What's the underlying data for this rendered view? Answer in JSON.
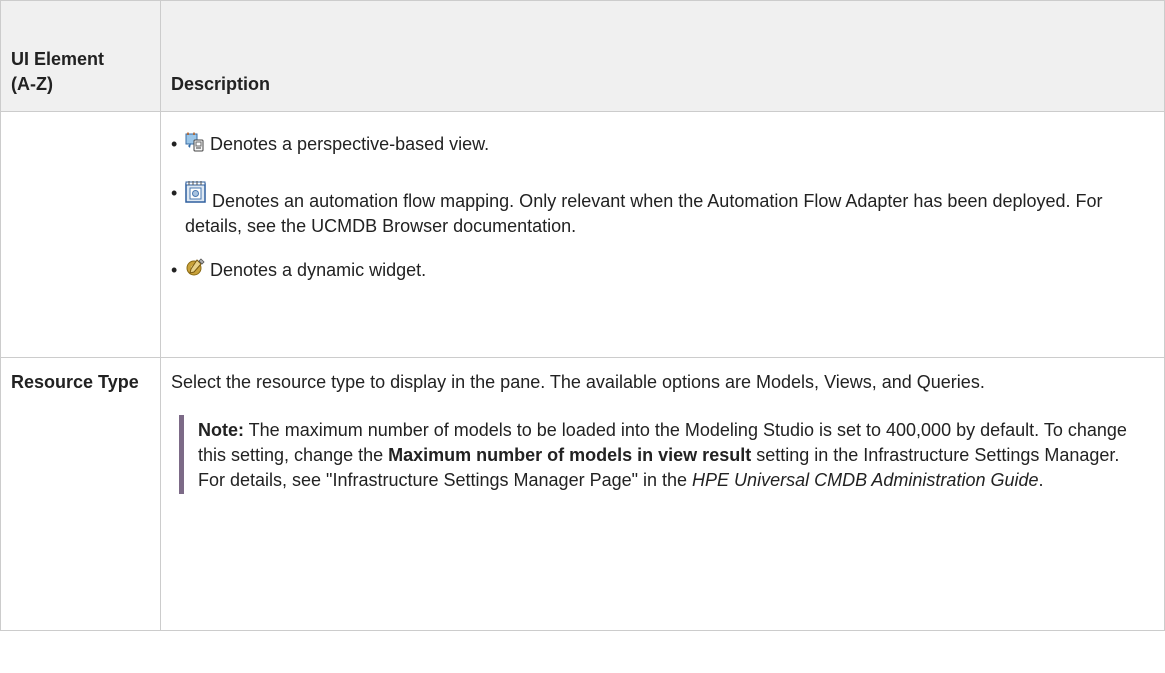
{
  "table": {
    "header": {
      "col1_line1": "UI Element",
      "col1_line2": "(A-Z)",
      "col2": "Description"
    },
    "icon_row": {
      "items": [
        {
          "icon": "perspective-view-icon",
          "text": "Denotes a perspective-based view."
        },
        {
          "icon": "automation-flow-icon",
          "text": "Denotes an automation flow mapping. Only relevant when the Automation Flow Adapter has been deployed. For details, see the UCMDB Browser documentation."
        },
        {
          "icon": "dynamic-widget-icon",
          "text": "Denotes a dynamic widget."
        }
      ]
    },
    "resource_row": {
      "element": "Resource Type",
      "description": "Select the resource type to display in the pane. The available options are Models, Views, and Queries.",
      "note": {
        "label": "Note:",
        "text_1": " The maximum number of models to be loaded into the Modeling Studio is set to 400,000 by default. To change this setting, change the ",
        "bold": "Maximum number of models in view result",
        "text_2": " setting in the Infrastructure Settings Manager. For details, see \"Infrastructure Settings Manager Page\" in the ",
        "italic": "HPE Universal CMDB Administration Guide",
        "text_3": "."
      }
    }
  },
  "colors": {
    "header_bg": "#f0f0f0",
    "border": "#cccccc",
    "note_bar": "#7c6a87"
  }
}
